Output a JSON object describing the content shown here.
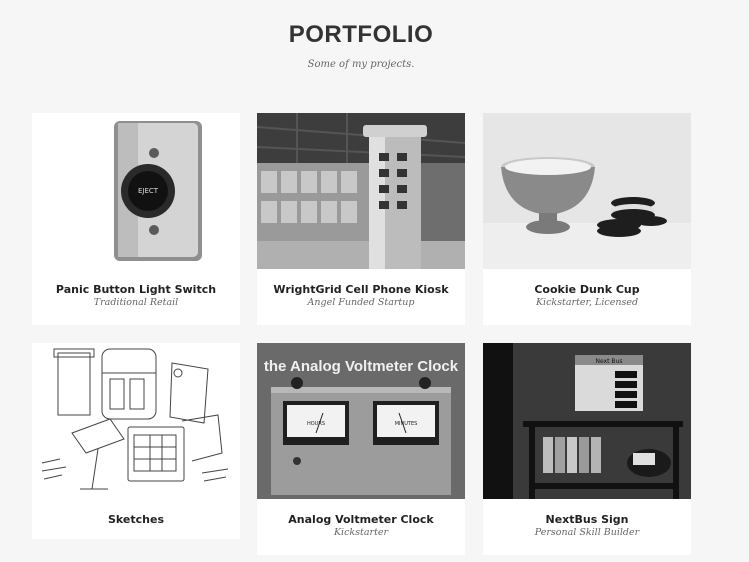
{
  "header": {
    "title": "PORTFOLIO",
    "subtitle": "Some of my projects."
  },
  "projects": [
    {
      "title": "Panic Button Light Switch",
      "subtitle": "Traditional Retail",
      "image_label": "EJECT"
    },
    {
      "title": "WrightGrid Cell Phone Kiosk",
      "subtitle": "Angel Funded Startup"
    },
    {
      "title": "Cookie Dunk Cup",
      "subtitle": "Kickstarter, Licensed"
    },
    {
      "title": "Sketches",
      "subtitle": ""
    },
    {
      "title": "Analog Voltmeter Clock",
      "subtitle": "Kickstarter",
      "image_label": "the Analog Voltmeter Clock",
      "meter_left": "HOURS",
      "meter_right": "MINUTES"
    },
    {
      "title": "NextBus Sign",
      "subtitle": "Personal Skill Builder",
      "image_label": "Next Bus"
    }
  ]
}
